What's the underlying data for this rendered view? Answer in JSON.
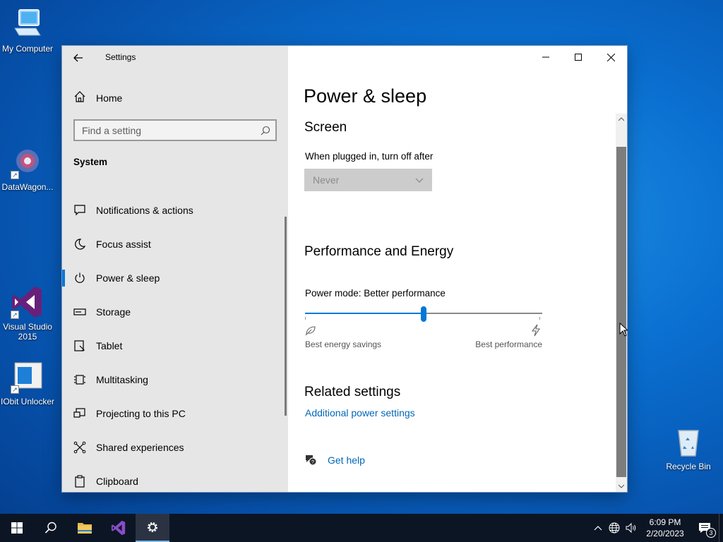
{
  "desktop": {
    "icons": [
      {
        "label": "My Computer"
      },
      {
        "label": "DataWagon..."
      },
      {
        "label": "Visual Studio 2015"
      },
      {
        "label": "IObit Unlocker"
      },
      {
        "label": "Recycle Bin"
      }
    ]
  },
  "window": {
    "app_title": "Settings",
    "sidebar": {
      "home_label": "Home",
      "search_placeholder": "Find a setting",
      "section": "System",
      "items": [
        {
          "label": "Notifications & actions",
          "icon": "notifications-icon"
        },
        {
          "label": "Focus assist",
          "icon": "moon-icon"
        },
        {
          "label": "Power & sleep",
          "icon": "power-icon",
          "active": true
        },
        {
          "label": "Storage",
          "icon": "storage-icon"
        },
        {
          "label": "Tablet",
          "icon": "tablet-icon"
        },
        {
          "label": "Multitasking",
          "icon": "multitasking-icon"
        },
        {
          "label": "Projecting to this PC",
          "icon": "projecting-icon"
        },
        {
          "label": "Shared experiences",
          "icon": "shared-icon"
        },
        {
          "label": "Clipboard",
          "icon": "clipboard-icon"
        }
      ]
    },
    "main": {
      "page_title": "Power & sleep",
      "screen_heading": "Screen",
      "plugged_label": "When plugged in, turn off after",
      "plugged_value": "Never",
      "perf_heading": "Performance and Energy",
      "power_mode_label": "Power mode: Better performance",
      "slider_value_fraction": 0.5,
      "slider_left_caption": "Best energy savings",
      "slider_right_caption": "Best performance",
      "related_heading": "Related settings",
      "related_link": "Additional power settings",
      "help_link": "Get help"
    }
  },
  "taskbar": {
    "time": "6:09 PM",
    "date": "2/20/2023",
    "notification_count": "3"
  },
  "colors": {
    "accent": "#0078d7",
    "link": "#0067b8",
    "sidebar_bg": "#e6e6e6"
  }
}
